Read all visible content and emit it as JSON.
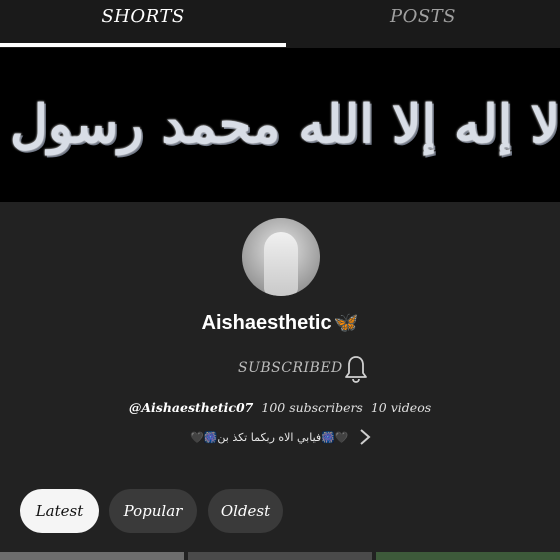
{
  "tabs": [
    {
      "label": "SHORTS",
      "active": true
    },
    {
      "label": "POSTS",
      "active": false
    }
  ],
  "banner": {
    "calligraphy": "لا إله إلا الله محمد رسول الله"
  },
  "channel": {
    "name": "Aishaesthetic",
    "emoji": "🦋",
    "subscribe_label": "SUBSCRIBED",
    "handle": "@Aishaesthetic07",
    "subscribers": "100 subscribers",
    "videos": "10 videos",
    "about": "🖤🎆فيابي الاه ربكما تكذ بن🎆🖤"
  },
  "filters": [
    {
      "label": "Latest",
      "selected": true
    },
    {
      "label": "Popular",
      "selected": false
    },
    {
      "label": "Oldest",
      "selected": false
    }
  ],
  "colors": {
    "background": "#222222",
    "accent_butterfly": "#f39a2b"
  }
}
